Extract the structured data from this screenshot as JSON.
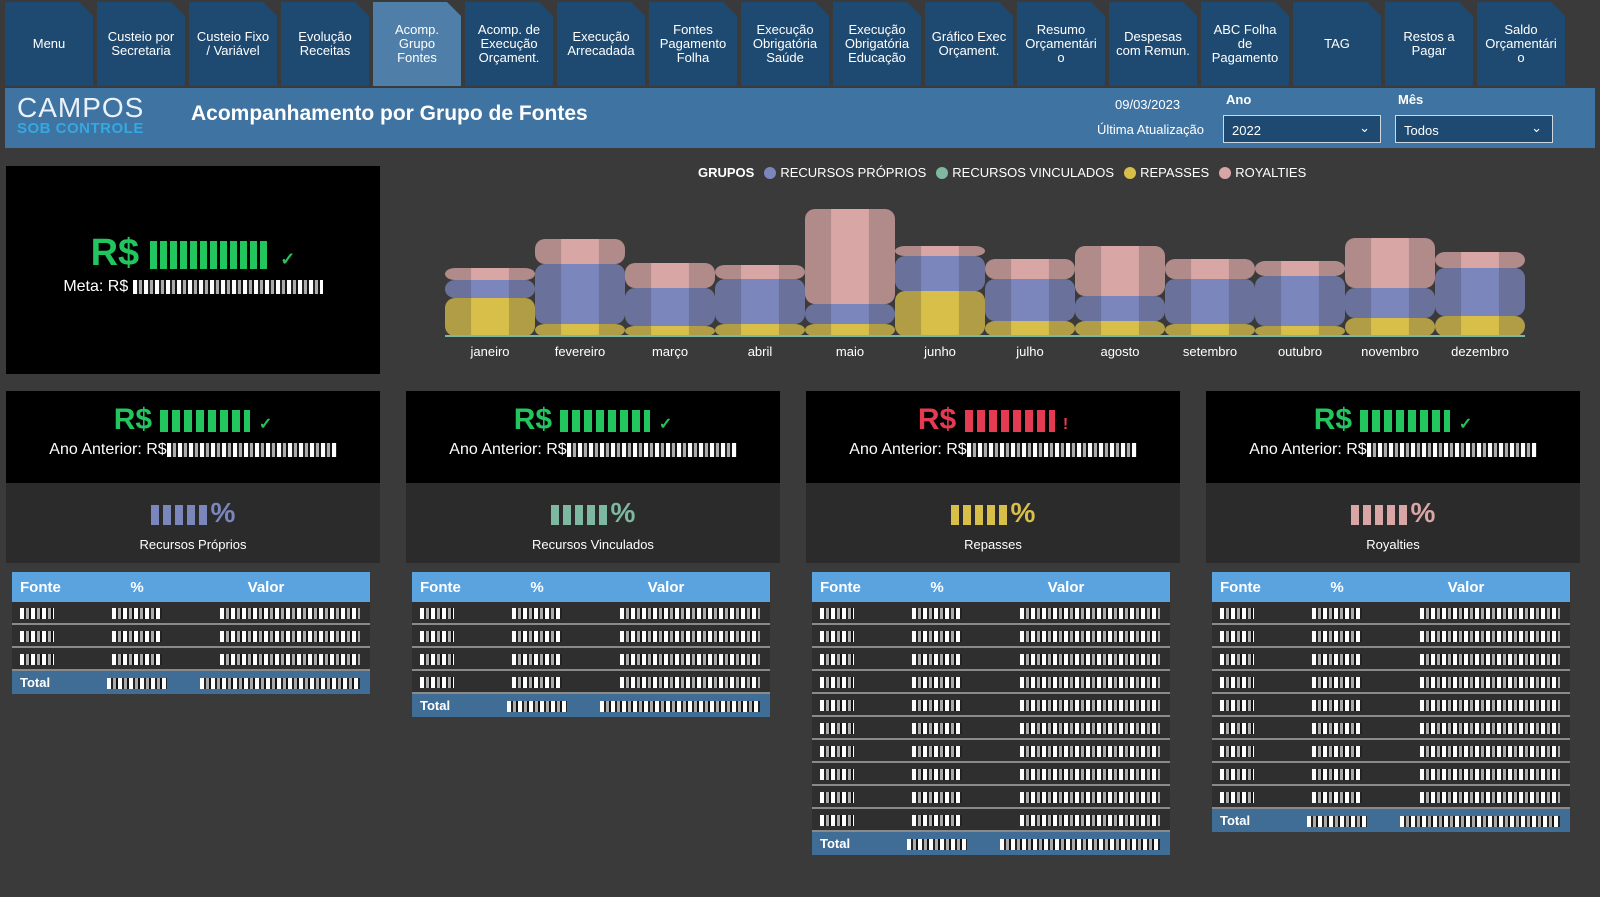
{
  "tabs": [
    {
      "label": "Menu",
      "active": false
    },
    {
      "label": "Custeio por\nSecretaria",
      "active": false
    },
    {
      "label": "Custeio Fixo\n/ Variável",
      "active": false
    },
    {
      "label": "Evolução\nReceitas",
      "active": false
    },
    {
      "label": "Acomp.\nGrupo\nFontes",
      "active": true
    },
    {
      "label": "Acomp. de\nExecução\nOrçament.",
      "active": false
    },
    {
      "label": "Execução\nArrecadada",
      "active": false
    },
    {
      "label": "Fontes\nPagamento\nFolha",
      "active": false
    },
    {
      "label": "Execução\nObrigatória\nSaúde",
      "active": false
    },
    {
      "label": "Execução\nObrigatória\nEducação",
      "active": false
    },
    {
      "label": "Gráfico Exec\nOrçament.",
      "active": false
    },
    {
      "label": "Resumo\nOrçamentári\no",
      "active": false
    },
    {
      "label": "Despesas\ncom Remun.",
      "active": false
    },
    {
      "label": "ABC Folha\nde\nPagamento",
      "active": false
    },
    {
      "label": "TAG",
      "active": false
    },
    {
      "label": "Restos a\nPagar",
      "active": false
    },
    {
      "label": "Saldo\nOrçamentári\no",
      "active": false
    }
  ],
  "header": {
    "logo_line1": "CAMPOS",
    "logo_line2": "SOB CONTROLE",
    "title": "Acompanhamento por Grupo de Fontes",
    "date": "09/03/2023",
    "update_label": "Última Atualização",
    "year_label": "Ano",
    "year_value": "2022",
    "month_label": "Mês",
    "month_value": "Todos"
  },
  "summary": {
    "currency": "R$",
    "check": "✓",
    "meta_label": "Meta: R$"
  },
  "legend": {
    "title": "GRUPOS",
    "items": [
      {
        "label": "RECURSOS PRÓPRIOS",
        "color": "#7b86bd"
      },
      {
        "label": "RECURSOS VINCULADOS",
        "color": "#7fb8a0"
      },
      {
        "label": "REPASSES",
        "color": "#d8bf4a"
      },
      {
        "label": "ROYALTIES",
        "color": "#d9a6a6"
      }
    ]
  },
  "chart_data": {
    "type": "area",
    "categories": [
      "janeiro",
      "fevereiro",
      "março",
      "abril",
      "maio",
      "junho",
      "julho",
      "agosto",
      "setembro",
      "outubro",
      "novembro",
      "dezembro"
    ],
    "series": [
      {
        "name": "RECURSOS PRÓPRIOS",
        "values": [
          18,
          60,
          38,
          45,
          20,
          35,
          42,
          25,
          45,
          50,
          30,
          48
        ]
      },
      {
        "name": "RECURSOS VINCULADOS",
        "values": [
          2,
          3,
          2,
          3,
          3,
          2,
          3,
          2,
          3,
          3,
          2,
          3
        ]
      },
      {
        "name": "REPASSES",
        "values": [
          38,
          12,
          10,
          12,
          12,
          45,
          15,
          15,
          12,
          10,
          18,
          20
        ]
      },
      {
        "name": "ROYALTIES",
        "values": [
          12,
          25,
          25,
          14,
          95,
          10,
          20,
          50,
          20,
          15,
          50,
          16
        ]
      }
    ]
  },
  "cards": [
    {
      "name": "Recursos Próprios",
      "prev_label": "Ano Anterior: R$",
      "currency": "R$",
      "status": "✓",
      "status_color": "#22c55e",
      "pct_color": "#7b86bd",
      "pct_sign": "%"
    },
    {
      "name": "Recursos Vinculados",
      "prev_label": "Ano Anterior: R$",
      "currency": "R$",
      "status": "✓",
      "status_color": "#22c55e",
      "pct_color": "#7fb8a0",
      "pct_sign": "%"
    },
    {
      "name": "Repasses",
      "prev_label": "Ano Anterior: R$",
      "currency": "R$",
      "status": "!",
      "status_color": "#e43a52",
      "pct_color": "#d8bf4a",
      "pct_sign": "%"
    },
    {
      "name": "Royalties",
      "prev_label": "Ano Anterior: R$",
      "currency": "R$",
      "status": "✓",
      "status_color": "#22c55e",
      "pct_color": "#d9a6a6",
      "pct_sign": "%"
    }
  ],
  "table_headers": {
    "fonte": "Fonte",
    "pct": "%",
    "valor": "Valor"
  },
  "tables": [
    {
      "rows": 3,
      "total_label": "Total"
    },
    {
      "rows": 4,
      "total_label": "Total"
    },
    {
      "rows": 10,
      "total_label": "Total"
    },
    {
      "rows": 9,
      "total_label": "Total"
    }
  ]
}
